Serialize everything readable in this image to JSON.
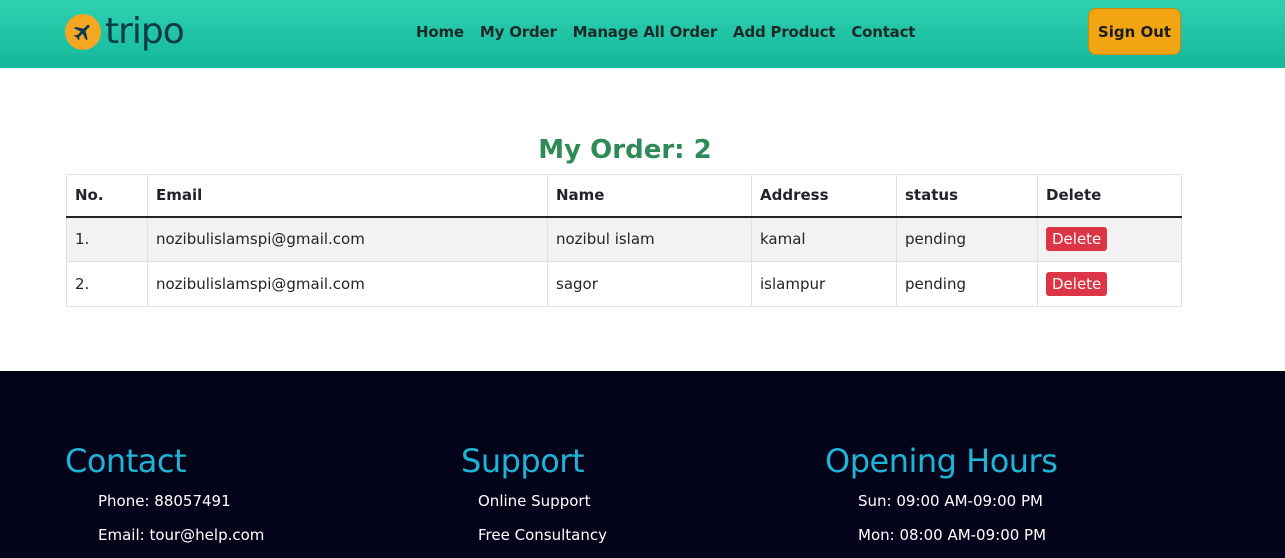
{
  "brand": {
    "name": "tripo"
  },
  "nav": {
    "items": [
      "Home",
      "My Order",
      "Manage All Order",
      "Add Product",
      "Contact"
    ],
    "signout_label": "Sign Out"
  },
  "orders": {
    "title": "My Order: 2",
    "columns": [
      "No.",
      "Email",
      "Name",
      "Address",
      "status",
      "Delete"
    ],
    "rows": [
      {
        "no": "1.",
        "email": "nozibulislamspi@gmail.com",
        "name": "nozibul islam",
        "address": "kamal",
        "status": "pending",
        "action": "Delete"
      },
      {
        "no": "2.",
        "email": "nozibulislamspi@gmail.com",
        "name": "sagor",
        "address": "islampur",
        "status": "pending",
        "action": "Delete"
      }
    ]
  },
  "footer": {
    "contact": {
      "title": "Contact",
      "items": [
        "Phone: 88057491",
        "Email: tour@help.com"
      ]
    },
    "support": {
      "title": "Support",
      "items": [
        "Online Support",
        "Free Consultancy"
      ]
    },
    "hours": {
      "title": "Opening Hours",
      "items": [
        "Sun: 09:00 AM-09:00 PM",
        "Mon: 08:00 AM-09:00 PM"
      ]
    }
  },
  "colors": {
    "header_gradient": [
      "#2fd1b0",
      "#13b89b"
    ],
    "accent": "#f2a513",
    "title_green": "#2e8b57",
    "danger": "#dc3545",
    "footer_bg": "#03031a",
    "footer_heading": "#1fb4d6"
  },
  "icons": {
    "logo": "airplane-icon"
  }
}
